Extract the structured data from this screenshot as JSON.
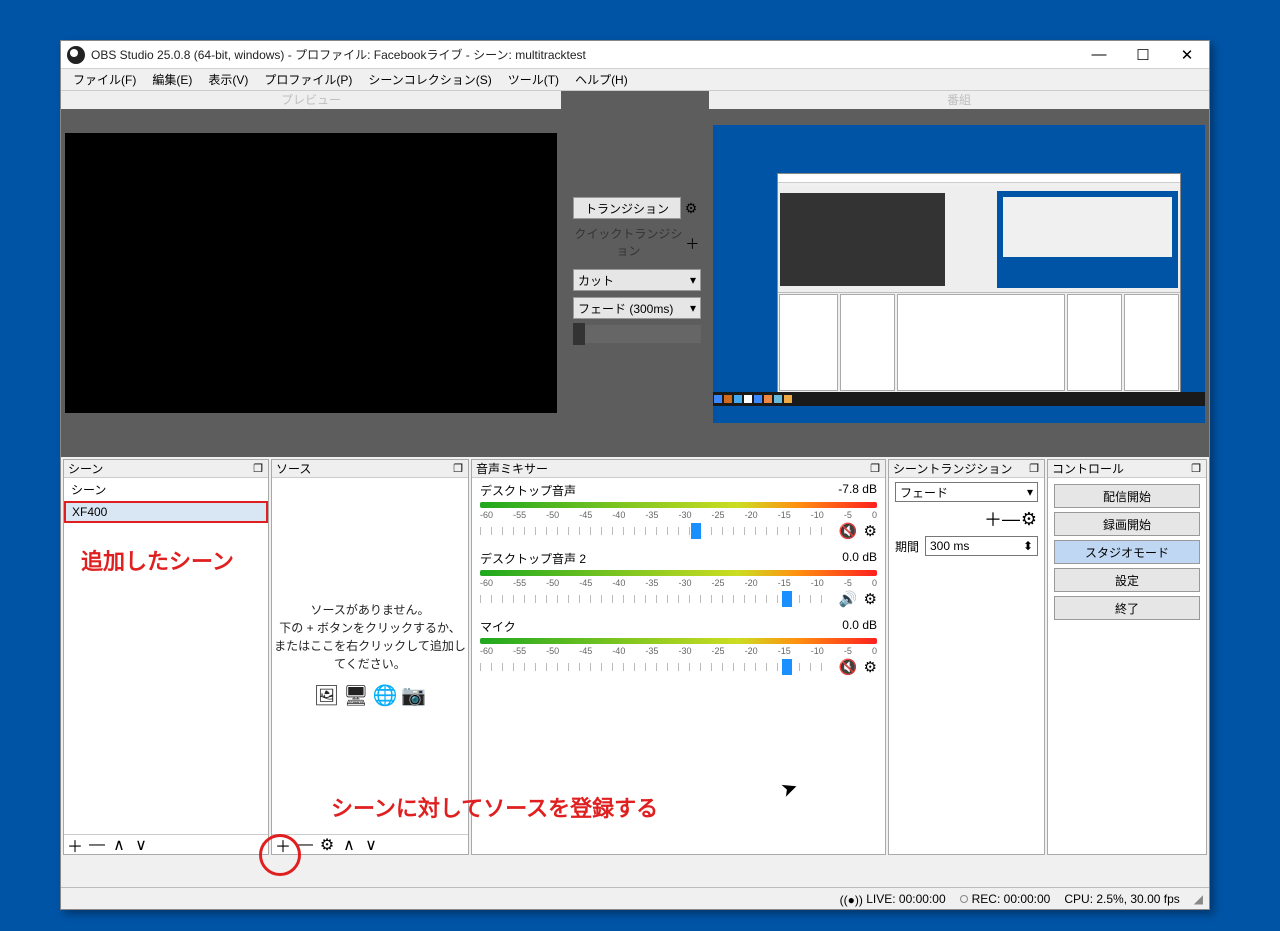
{
  "window": {
    "title": "OBS Studio 25.0.8 (64-bit, windows) - プロファイル: Facebookライブ - シーン: multitracktest"
  },
  "menu": {
    "file": "ファイル(F)",
    "edit": "編集(E)",
    "view": "表示(V)",
    "profile": "プロファイル(P)",
    "scenecol": "シーンコレクション(S)",
    "tool": "ツール(T)",
    "help": "ヘルプ(H)"
  },
  "labels": {
    "preview": "プレビュー",
    "program": "番組"
  },
  "center": {
    "transition_btn": "トランジション",
    "quick_label": "クイックトランジション",
    "cut": "カット",
    "fade": "フェード (300ms)"
  },
  "panels": {
    "scenes_title": "シーン",
    "sources_title": "ソース",
    "mixer_title": "音声ミキサー",
    "trans_title": "シーントランジション",
    "ctrl_title": "コントロール"
  },
  "scenes": {
    "item0": "シーン",
    "item1": "XF400"
  },
  "sources_empty": {
    "l1": "ソースがありません。",
    "l2": "下の + ボタンをクリックするか、",
    "l3": "またはここを右クリックして追加してください。"
  },
  "mixer": {
    "scale": [
      "-60",
      "-55",
      "-50",
      "-45",
      "-40",
      "-35",
      "-30",
      "-25",
      "-20",
      "-15",
      "-10",
      "-5",
      "0"
    ],
    "ch1": {
      "name": "デスクトップ音声",
      "db": "-7.8 dB"
    },
    "ch2": {
      "name": "デスクトップ音声 2",
      "db": "0.0 dB"
    },
    "ch3": {
      "name": "マイク",
      "db": "0.0 dB"
    }
  },
  "trans": {
    "selected": "フェード",
    "duration_label": "期間",
    "duration_value": "300 ms"
  },
  "controls": {
    "start_stream": "配信開始",
    "start_record": "録画開始",
    "studio": "スタジオモード",
    "settings": "設定",
    "exit": "終了"
  },
  "status": {
    "live": "LIVE: 00:00:00",
    "rec": "REC: 00:00:00",
    "cpu": "CPU: 2.5%, 30.00 fps"
  },
  "annotations": {
    "added_scene": "追加したシーン",
    "register_source": "シーンに対してソースを登録する"
  }
}
